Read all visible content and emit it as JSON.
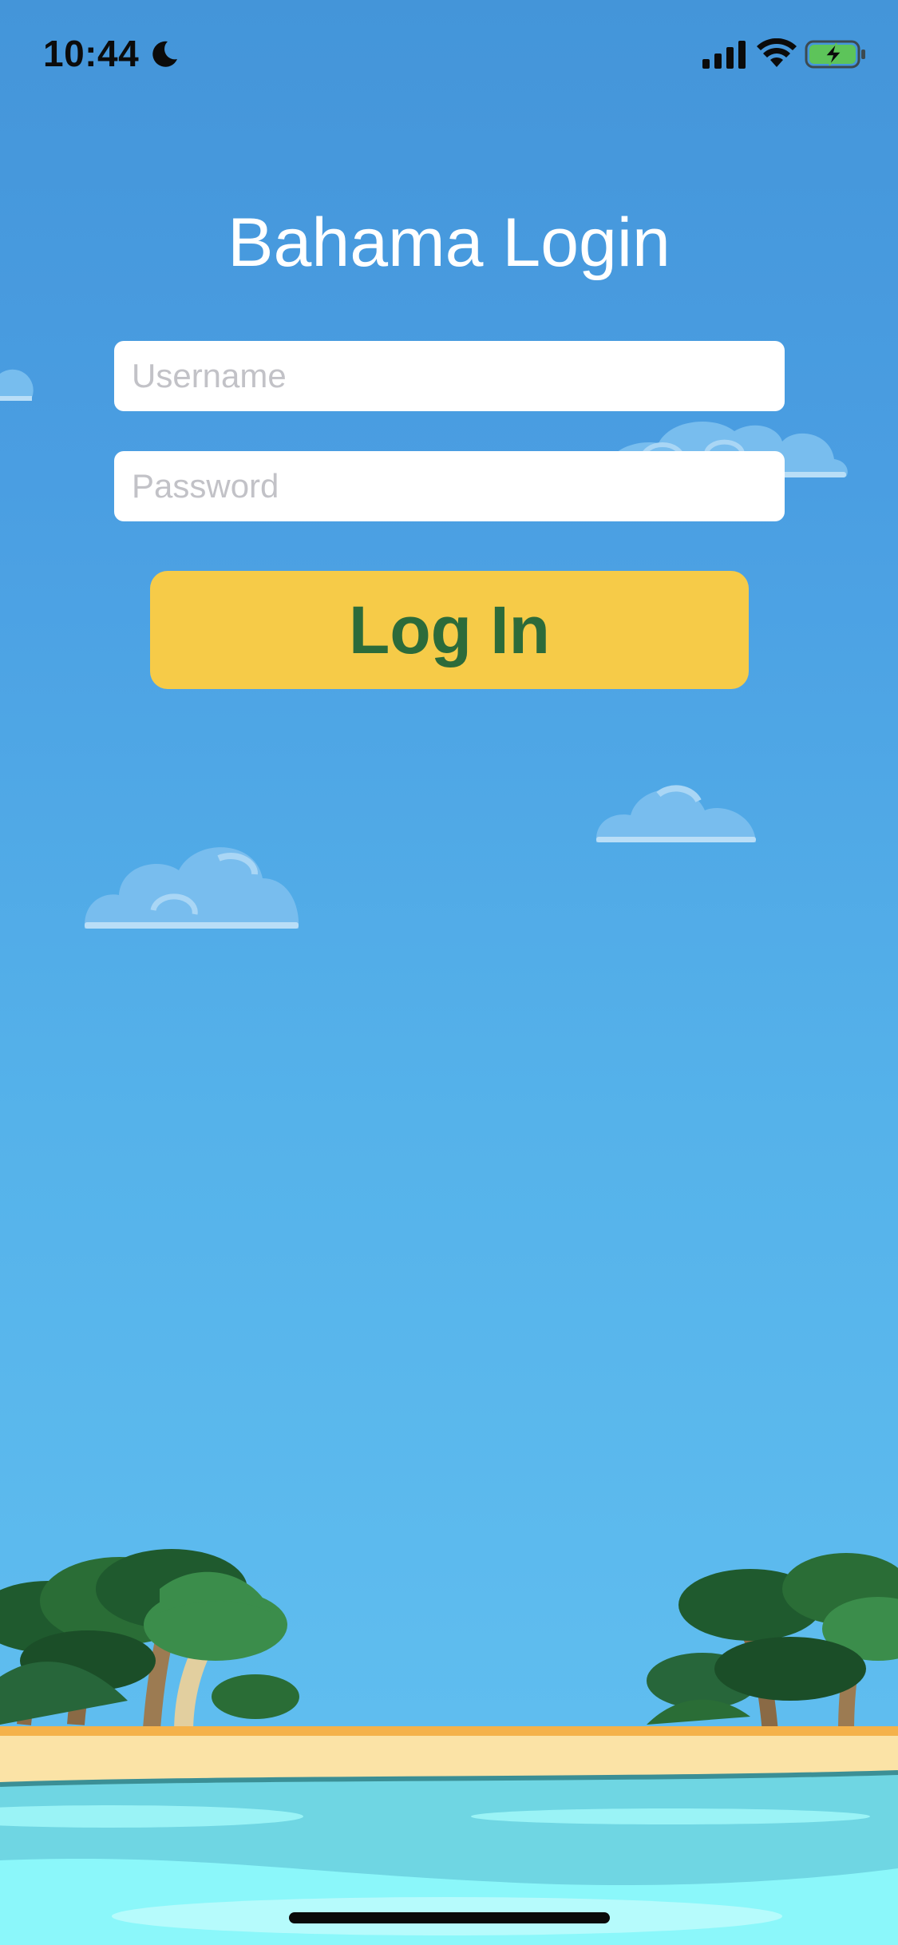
{
  "status_bar": {
    "time": "10:44",
    "icons": [
      "moon-icon",
      "cellular-signal-icon",
      "wifi-icon",
      "battery-charging-icon"
    ]
  },
  "login": {
    "title": "Bahama Login",
    "username_placeholder": "Username",
    "username_value": "",
    "password_placeholder": "Password",
    "password_value": "",
    "login_button_label": "Log In"
  },
  "colors": {
    "sky_top": "#4495d9",
    "sky_bottom": "#5fbdef",
    "button_fill": "#f6cb48",
    "button_text": "#2c6b3a",
    "title_text": "#ffffff",
    "sand": "#fbe3a6",
    "water": "#6fdce8"
  }
}
